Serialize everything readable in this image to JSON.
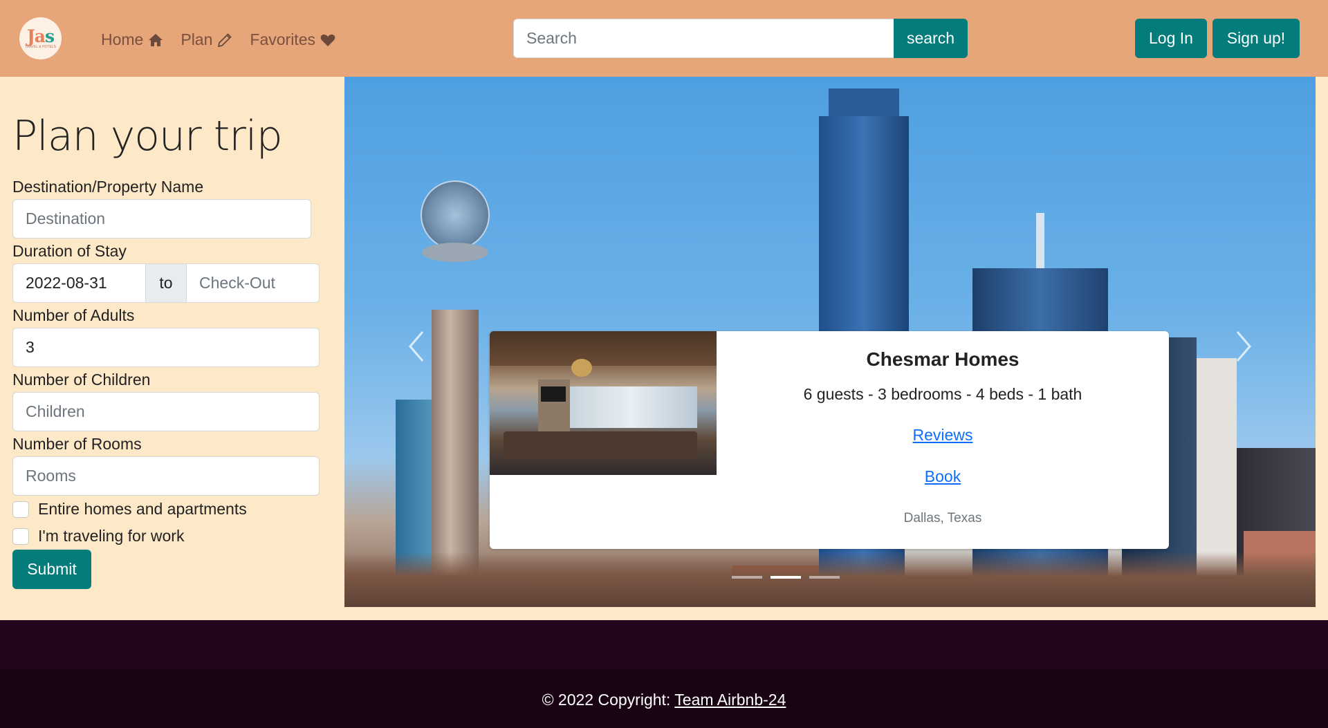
{
  "nav": {
    "logo_text": "Jas",
    "logo_sub": "TRAVEL & HOTELS",
    "links": [
      {
        "label": "Home",
        "icon": "home-icon"
      },
      {
        "label": "Plan",
        "icon": "pencil-icon"
      },
      {
        "label": "Favorites",
        "icon": "heart-icon"
      }
    ],
    "search_placeholder": "Search",
    "search_button": "search",
    "login": "Log In",
    "signup": "Sign up!"
  },
  "form": {
    "title": "Plan your trip",
    "destination_label": "Destination/Property Name",
    "destination_placeholder": "Destination",
    "duration_label": "Duration of Stay",
    "checkin_value": "2022-08-31",
    "to_label": "to",
    "checkout_placeholder": "Check-Out",
    "adults_label": "Number of Adults",
    "adults_value": "3",
    "children_label": "Number of Children",
    "children_placeholder": "Children",
    "rooms_label": "Number of Rooms",
    "rooms_placeholder": "Rooms",
    "check_entire": "Entire homes and apartments",
    "check_work": "I'm traveling for work",
    "submit": "Submit"
  },
  "carousel": {
    "card": {
      "title": "Chesmar Homes",
      "details": "6 guests - 3 bedrooms - 4 beds - 1 bath",
      "reviews": "Reviews",
      "book": "Book",
      "location": "Dallas, Texas"
    },
    "slides": 3,
    "active_slide": 2
  },
  "footer": {
    "copyright_prefix": "© 2022 Copyright: ",
    "team_link": "Team Airbnb-24"
  },
  "colors": {
    "navbar": "#e6a679",
    "teal": "#037c7b",
    "panel": "#fde8c8",
    "footer": "#22061d"
  }
}
